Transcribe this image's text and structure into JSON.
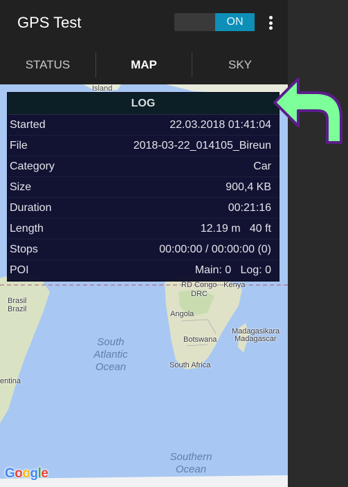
{
  "app": {
    "title": "GPS Test",
    "toggle_label": "ON",
    "accent_color": "#0e8fb8"
  },
  "tabs": [
    {
      "label": "STATUS",
      "active": false
    },
    {
      "label": "MAP",
      "active": true
    },
    {
      "label": "SKY",
      "active": false
    }
  ],
  "log": {
    "header": "LOG",
    "rows": [
      {
        "label": "Started",
        "value": "22.03.2018 01:41:04"
      },
      {
        "label": "File",
        "value": "2018-03-22_014105_Bireun"
      },
      {
        "label": "Category",
        "value": "Car"
      },
      {
        "label": "Size",
        "value": "900,4 KB"
      },
      {
        "label": "Duration",
        "value": "00:21:16"
      },
      {
        "label": "Length",
        "value": "12.19 m   40 ft"
      },
      {
        "label": "Stops",
        "value": "00:00:00 / 00:00:00 (0)"
      },
      {
        "label": "POI",
        "value": "Main: 0   Log: 0"
      }
    ]
  },
  "map": {
    "labels": {
      "island": "Island",
      "rd_congo_kenya": "RD Congo · Kenya",
      "drc": "DRC",
      "brasil": "Brasil",
      "brazil": "Brazil",
      "angola": "Angola",
      "botswana": "Botswana",
      "madagasikara": "Madagasikara",
      "madagascar": "Madagascar",
      "south_africa": "South Africa",
      "entina": "entina"
    },
    "oceans": {
      "south_atlantic": "South Atlantic Ocean",
      "southern": "Southern Ocean"
    },
    "attribution": "Google"
  },
  "annotation": {
    "arrow_color": "#7dff9a",
    "arrow_outline": "#5a1e8a"
  }
}
